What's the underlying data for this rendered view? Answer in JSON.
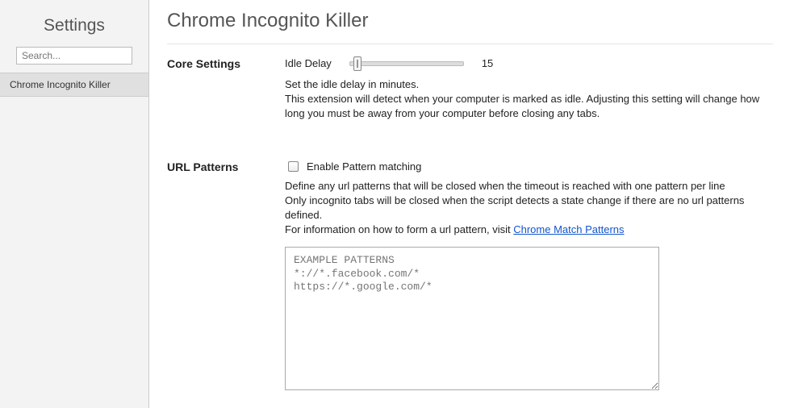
{
  "sidebar": {
    "title": "Settings",
    "search_placeholder": "Search...",
    "items": [
      {
        "label": "Chrome Incognito Killer"
      }
    ]
  },
  "page": {
    "title": "Chrome Incognito Killer"
  },
  "core_settings": {
    "heading": "Core Settings",
    "idle_delay_label": "Idle Delay",
    "idle_delay_value": "15",
    "desc_line1": "Set the idle delay in minutes.",
    "desc_line2": "This extension will detect when your computer is marked as idle. Adjusting this setting will change how long you must be away from your computer before closing any tabs."
  },
  "url_patterns": {
    "heading": "URL Patterns",
    "checkbox_label": "Enable Pattern matching",
    "desc_line1": "Define any url patterns that will be closed when the timeout is reached with one pattern per line",
    "desc_line2": "Only incognito tabs will be closed when the script detects a state change if there are no url patterns defined.",
    "desc_line3_prefix": "For information on how to form a url pattern, visit ",
    "desc_line3_link": "Chrome Match Patterns",
    "textarea_placeholder": "EXAMPLE PATTERNS\n*://*.facebook.com/*\nhttps://*.google.com/*"
  }
}
